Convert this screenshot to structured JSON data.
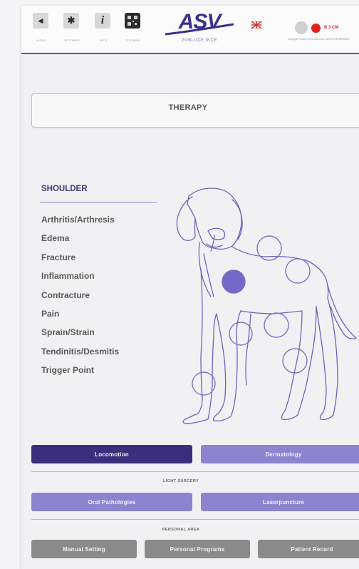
{
  "topbar": {
    "buttons": [
      {
        "icon": "speaker-icon",
        "label": "AUDIO"
      },
      {
        "icon": "gear-icon",
        "label": "SETTINGS"
      },
      {
        "icon": "info-icon",
        "label": "INFO"
      },
      {
        "icon": "qr-code-icon",
        "label": "TUTORIAL"
      }
    ],
    "logo_text": "ASV",
    "logo_subtitle": "ZUBLUCE IKCE",
    "language_icon": "uk-flag-icon",
    "status_text": "B 3 CM",
    "copyright": "Copyright © ASV S.R.L 2020 ALL RIGHTS RESERVED"
  },
  "therapy": {
    "title": "THERAPY"
  },
  "panel": {
    "section_title": "SHOULDER",
    "conditions": [
      "Arthritis/Arthresis",
      "Edema",
      "Fracture",
      "Inflammation",
      "Contracture",
      "Pain",
      "Sprain/Strain",
      "Tendinitis/Desmitis",
      "Trigger Point"
    ]
  },
  "body_map": {
    "points": [
      {
        "name": "neck",
        "selected": false
      },
      {
        "name": "shoulder",
        "selected": true
      },
      {
        "name": "back",
        "selected": false
      },
      {
        "name": "hip",
        "selected": false
      },
      {
        "name": "elbow",
        "selected": false
      },
      {
        "name": "stifle",
        "selected": false
      },
      {
        "name": "hock",
        "selected": false
      },
      {
        "name": "carpus",
        "selected": false
      }
    ]
  },
  "nav": {
    "locomotion": "Locomotion",
    "dermatology": "Dermatology",
    "light_surgery_title": "LIGHT SURGERY",
    "oral_pathologies": "Oral Pathologies",
    "laserpuncture": "Laserpuncture",
    "personal_area_title": "PERSONAL AREA",
    "manual_setting": "Manual Setting",
    "personal_programs": "Personal Programs",
    "patient_record": "Patient Record"
  },
  "colors": {
    "accent": "#3b2f7d",
    "accent_light": "#8d83cf",
    "status_red": "#e0211a",
    "outline": "#6b63c0"
  }
}
